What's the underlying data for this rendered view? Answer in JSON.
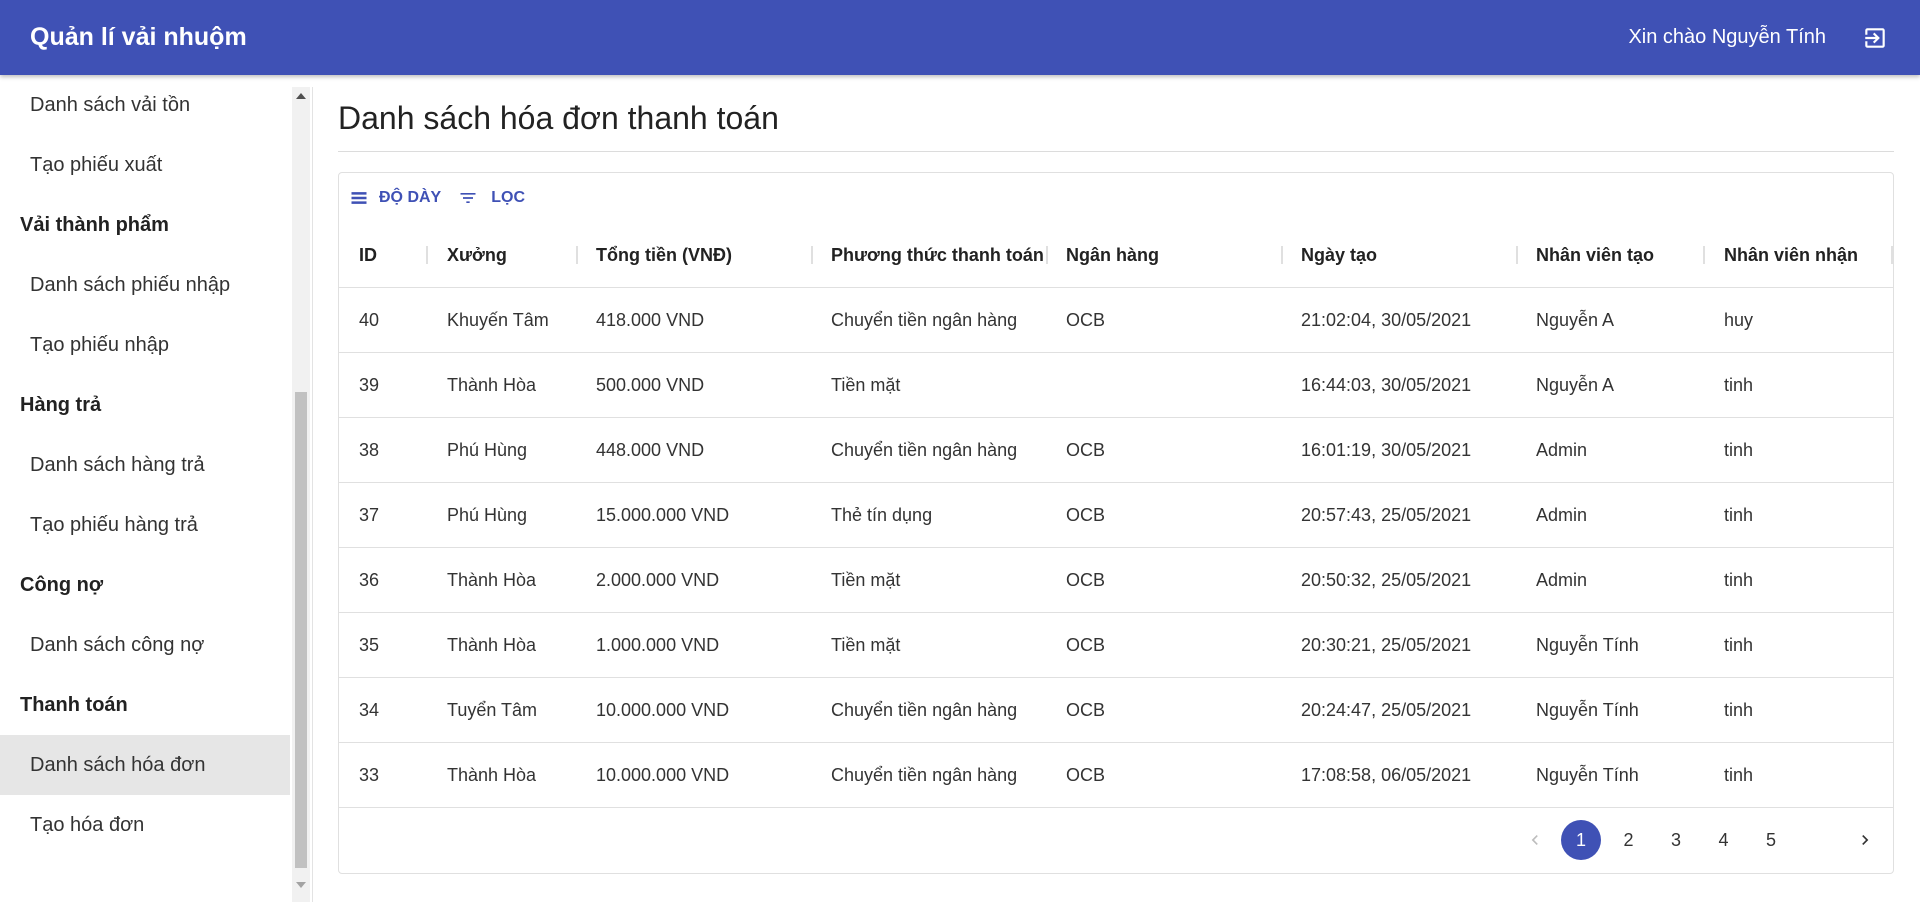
{
  "header": {
    "app_title": "Quản lí vải nhuộm",
    "greeting": "Xin chào Nguyễn Tính",
    "logout_icon": "logout-icon"
  },
  "sidebar": {
    "items": [
      {
        "label": "Danh sách vải tồn",
        "kind": "sub",
        "active": false
      },
      {
        "label": "Tạo phiếu xuất",
        "kind": "sub",
        "active": false
      },
      {
        "label": "Vải thành phẩm",
        "kind": "header",
        "active": false
      },
      {
        "label": "Danh sách phiếu nhập",
        "kind": "sub",
        "active": false
      },
      {
        "label": "Tạo phiếu nhập",
        "kind": "sub",
        "active": false
      },
      {
        "label": "Hàng trả",
        "kind": "header",
        "active": false
      },
      {
        "label": "Danh sách hàng trả",
        "kind": "sub",
        "active": false
      },
      {
        "label": "Tạo phiếu hàng trả",
        "kind": "sub",
        "active": false
      },
      {
        "label": "Công nợ",
        "kind": "header",
        "active": false
      },
      {
        "label": "Danh sách công nợ",
        "kind": "sub",
        "active": false
      },
      {
        "label": "Thanh toán",
        "kind": "header",
        "active": false
      },
      {
        "label": "Danh sách hóa đơn",
        "kind": "sub",
        "active": true
      },
      {
        "label": "Tạo hóa đơn",
        "kind": "sub",
        "active": false
      }
    ]
  },
  "main": {
    "page_title": "Danh sách hóa đơn thanh toán",
    "toolbar": {
      "density_label": "ĐỘ DÀY",
      "filter_label": "LỌC"
    },
    "columns": [
      "ID",
      "Xưởng",
      "Tổng tiền (VNĐ)",
      "Phương thức thanh toán",
      "Ngân hàng",
      "Ngày tạo",
      "Nhân viên tạo",
      "Nhân viên nhận"
    ],
    "rows": [
      [
        "40",
        "Khuyến Tâm",
        "418.000 VND",
        "Chuyển tiền ngân hàng",
        "OCB",
        "21:02:04, 30/05/2021",
        "Nguyễn A",
        "huy"
      ],
      [
        "39",
        "Thành Hòa",
        "500.000 VND",
        "Tiền mặt",
        "",
        "16:44:03, 30/05/2021",
        "Nguyễn A",
        "tinh"
      ],
      [
        "38",
        "Phú Hùng",
        "448.000 VND",
        "Chuyển tiền ngân hàng",
        "OCB",
        "16:01:19, 30/05/2021",
        "Admin",
        "tinh"
      ],
      [
        "37",
        "Phú Hùng",
        "15.000.000 VND",
        "Thẻ tín dụng",
        "OCB",
        "20:57:43, 25/05/2021",
        "Admin",
        "tinh"
      ],
      [
        "36",
        "Thành Hòa",
        "2.000.000 VND",
        "Tiền mặt",
        "OCB",
        "20:50:32, 25/05/2021",
        "Admin",
        "tinh"
      ],
      [
        "35",
        "Thành Hòa",
        "1.000.000 VND",
        "Tiền mặt",
        "OCB",
        "20:30:21, 25/05/2021",
        "Nguyễn Tính",
        "tinh"
      ],
      [
        "34",
        "Tuyển Tâm",
        "10.000.000 VND",
        "Chuyển tiền ngân hàng",
        "OCB",
        "20:24:47, 25/05/2021",
        "Nguyễn Tính",
        "tinh"
      ],
      [
        "33",
        "Thành Hòa",
        "10.000.000 VND",
        "Chuyển tiền ngân hàng",
        "OCB",
        "17:08:58, 06/05/2021",
        "Nguyễn Tính",
        "tinh"
      ]
    ],
    "pagination": {
      "pages": [
        "1",
        "2",
        "3",
        "4",
        "5"
      ],
      "current": "1"
    }
  },
  "colors": {
    "primary": "#3f51b5",
    "active_item_bg": "#e6e6e6"
  }
}
